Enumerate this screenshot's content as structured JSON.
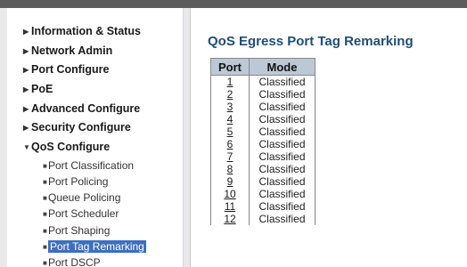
{
  "sidebar": {
    "menu": [
      {
        "label": "Information & Status",
        "expanded": false
      },
      {
        "label": "Network Admin",
        "expanded": false
      },
      {
        "label": "Port Configure",
        "expanded": false
      },
      {
        "label": "PoE",
        "expanded": false
      },
      {
        "label": "Advanced Configure",
        "expanded": false
      },
      {
        "label": "Security Configure",
        "expanded": false
      },
      {
        "label": "QoS Configure",
        "expanded": true
      }
    ],
    "qos_submenu": [
      {
        "label": "Port Classification",
        "active": false
      },
      {
        "label": "Port Policing",
        "active": false
      },
      {
        "label": "Queue Policing",
        "active": false
      },
      {
        "label": "Port Scheduler",
        "active": false
      },
      {
        "label": "Port Shaping",
        "active": false
      },
      {
        "label": "Port Tag Remarking",
        "active": true
      },
      {
        "label": "Port DSCP",
        "active": false
      }
    ]
  },
  "main": {
    "title": "QoS Egress Port Tag Remarking",
    "table": {
      "headers": [
        "Port",
        "Mode"
      ],
      "rows": [
        {
          "port": "1",
          "mode": "Classified"
        },
        {
          "port": "2",
          "mode": "Classified"
        },
        {
          "port": "3",
          "mode": "Classified"
        },
        {
          "port": "4",
          "mode": "Classified"
        },
        {
          "port": "5",
          "mode": "Classified"
        },
        {
          "port": "6",
          "mode": "Classified"
        },
        {
          "port": "7",
          "mode": "Classified"
        },
        {
          "port": "8",
          "mode": "Classified"
        },
        {
          "port": "9",
          "mode": "Classified"
        },
        {
          "port": "10",
          "mode": "Classified"
        },
        {
          "port": "11",
          "mode": "Classified"
        },
        {
          "port": "12",
          "mode": "Classified"
        }
      ]
    }
  },
  "colors": {
    "title": "#1f4e79",
    "header_bg": "#bcc8d6",
    "active_item_bg": "#3f6fbd",
    "topbar": "#5c5c5c"
  },
  "icons": {
    "collapsed": "triangle-right-icon",
    "expanded": "triangle-down-icon",
    "bullet": "square-bullet-icon"
  }
}
